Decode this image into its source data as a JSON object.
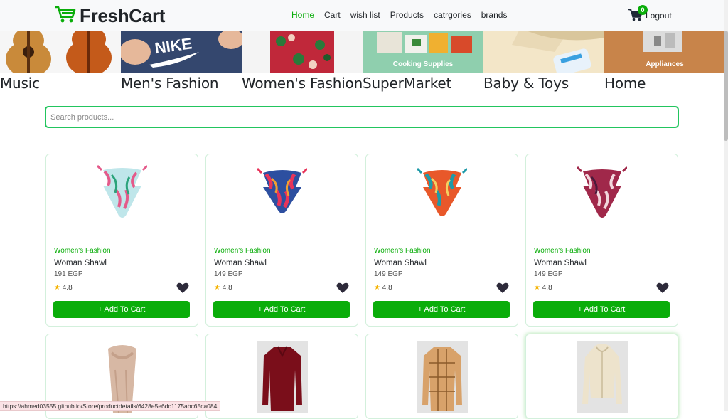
{
  "header": {
    "brand": "FreshCart",
    "nav": [
      "Home",
      "Cart",
      "wish list",
      "Products",
      "catrgories",
      "brands"
    ],
    "cart_count": "0",
    "logout": "Logout"
  },
  "categories_slider": [
    {
      "label": "Music",
      "caption": ""
    },
    {
      "label": "Men's Fashion",
      "caption": ""
    },
    {
      "label": "Women's Fashion",
      "caption": ""
    },
    {
      "label": "SuperMarket",
      "caption": "Cooking Supplies"
    },
    {
      "label": "Baby & Toys",
      "caption": ""
    },
    {
      "label": "Home",
      "caption": "Appliances"
    }
  ],
  "search": {
    "placeholder": "Search products..."
  },
  "products": [
    {
      "category": "Women's Fashion",
      "title": "Woman Shawl",
      "price": "191 EGP",
      "rating": "4.8",
      "button": "+ Add To Cart"
    },
    {
      "category": "Women's Fashion",
      "title": "Woman Shawl",
      "price": "149 EGP",
      "rating": "4.8",
      "button": "+ Add To Cart"
    },
    {
      "category": "Women's Fashion",
      "title": "Woman Shawl",
      "price": "149 EGP",
      "rating": "4.8",
      "button": "+ Add To Cart"
    },
    {
      "category": "Women's Fashion",
      "title": "Woman Shawl",
      "price": "149 EGP",
      "rating": "4.8",
      "button": "+ Add To Cart"
    }
  ],
  "status_url": "https://ahmed03555.github.io/Store/productdetails/6428e5e6dc1175abc65ca084",
  "colors": {
    "accent": "#0aad0a",
    "border": "#22c55e"
  }
}
